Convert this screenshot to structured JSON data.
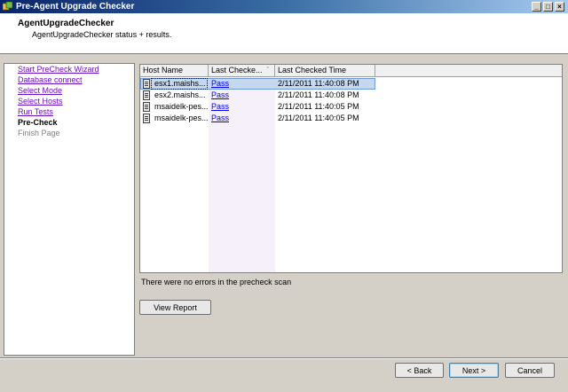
{
  "window": {
    "title": "Pre-Agent Upgrade Checker"
  },
  "header": {
    "title": "AgentUpgradeChecker",
    "subtitle": "AgentUpgradeChecker status + results."
  },
  "steps": [
    {
      "label": "Start PreCheck Wizard",
      "state": "link"
    },
    {
      "label": "Database connect",
      "state": "link"
    },
    {
      "label": "Select Mode",
      "state": "link"
    },
    {
      "label": "Select Hosts",
      "state": "link"
    },
    {
      "label": "Run Tests",
      "state": "link"
    },
    {
      "label": "Pre-Check",
      "state": "current"
    },
    {
      "label": "Finish Page",
      "state": "disabled"
    }
  ],
  "table": {
    "columns": [
      "Host Name",
      "Last Checke...",
      "Last Checked Time"
    ],
    "rows": [
      {
        "host": "esx1.maishs...",
        "status": "Pass",
        "time": "2/11/2011 11:40:08 PM",
        "selected": true
      },
      {
        "host": "esx2.maishs...",
        "status": "Pass",
        "time": "2/11/2011 11:40:08 PM",
        "selected": false
      },
      {
        "host": "msaidelk-pes...",
        "status": "Pass",
        "time": "2/11/2011 11:40:05 PM",
        "selected": false
      },
      {
        "host": "msaidelk-pes...",
        "status": "Pass",
        "time": "2/11/2011 11:40:05 PM",
        "selected": false
      }
    ]
  },
  "message": "There were no errors in the precheck scan",
  "buttons": {
    "view_report": "View Report",
    "back": "< Back",
    "next": "Next >",
    "cancel": "Cancel"
  },
  "titlebar_buttons": {
    "minimize": "_",
    "maximize": "□",
    "close": "×"
  },
  "colors": {
    "link": "#6b0fbf",
    "status_link": "#0000ee",
    "selection": "#c5d8ef"
  }
}
